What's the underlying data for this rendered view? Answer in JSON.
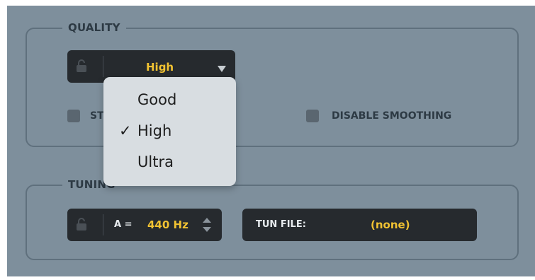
{
  "quality": {
    "title": "QUALITY",
    "selected": "High",
    "dropdown_arrow_icon": "triangle-down",
    "lock_icon": "padlock-open",
    "options": [
      {
        "label": "Good",
        "checked": false
      },
      {
        "label": "High",
        "checked": true
      },
      {
        "label": "Ultra",
        "checked": false
      }
    ],
    "check_glyph": "✓",
    "checkbox_left_label": "ST",
    "checkbox_right_label": "DISABLE SMOOTHING"
  },
  "tuning": {
    "title": "TUNING",
    "a_label": "A =",
    "a_value": "440 Hz",
    "stepper_icon": "up-down-stepper",
    "lock_icon": "padlock-open",
    "tun_file_label": "TUN FILE:",
    "tun_file_value": "(none)"
  },
  "colors": {
    "panel_bg": "#7e8f9c",
    "control_bg": "#262a2e",
    "accent_yellow": "#f1c232",
    "dropdown_bg": "#d8dde1"
  }
}
